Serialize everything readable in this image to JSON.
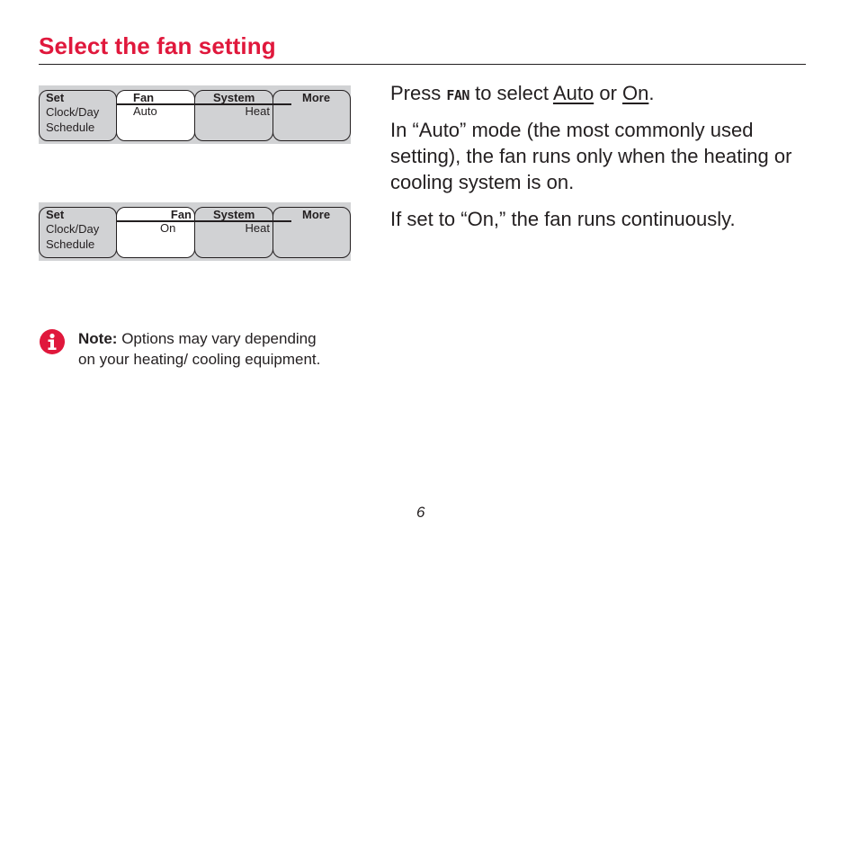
{
  "page": {
    "title": "Select the fan setting",
    "page_number": "6",
    "accent_color": "#e0183c"
  },
  "displays": [
    {
      "set_label": "Set",
      "clock_day": "Clock/Day",
      "schedule": "Schedule",
      "fan_label": "Fan",
      "fan_value": "Auto",
      "system_label": "System",
      "system_value": "Heat",
      "more_label": "More"
    },
    {
      "set_label": "Set",
      "clock_day": "Clock/Day",
      "schedule": "Schedule",
      "fan_label": "Fan",
      "fan_value": "On",
      "system_label": "System",
      "system_value": "Heat",
      "more_label": "More"
    }
  ],
  "instructions": {
    "press": "Press",
    "fan_key": "FAN",
    "to_select": "to select",
    "option_auto": "Auto",
    "or": "or",
    "option_on": "On",
    "period": ".",
    "auto_paragraph": "In “Auto” mode (the most commonly used setting), the fan runs only when the heating or cooling system is on.",
    "on_paragraph": "If set to “On,” the fan runs continuously."
  },
  "note": {
    "icon": "info-icon",
    "label": "Note:",
    "text": "Options may vary depending on your heating/ cooling equipment."
  }
}
